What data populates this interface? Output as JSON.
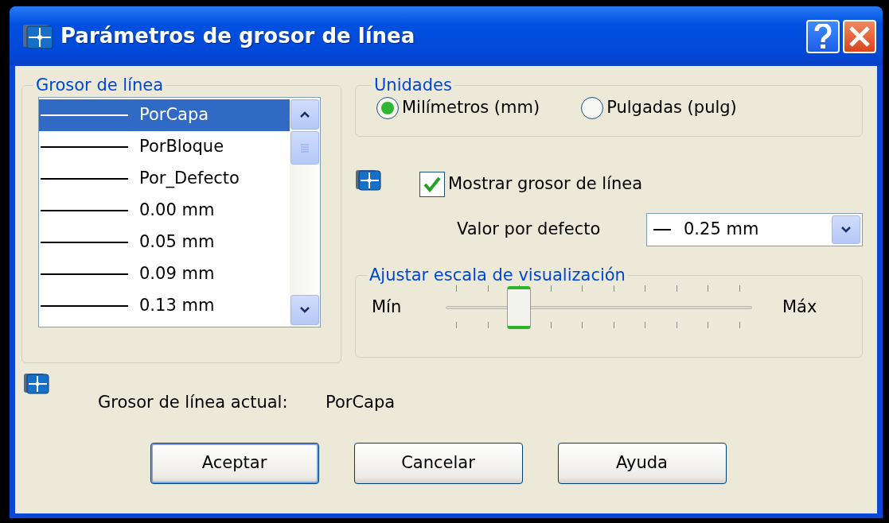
{
  "window": {
    "title": "Parámetros de grosor de línea"
  },
  "lineweights": {
    "title": "Grosor de línea",
    "items": [
      {
        "label": "PorCapa",
        "selected": true
      },
      {
        "label": "PorBloque",
        "selected": false
      },
      {
        "label": "Por_Defecto",
        "selected": false
      },
      {
        "label": "0.00 mm",
        "selected": false
      },
      {
        "label": "0.05 mm",
        "selected": false
      },
      {
        "label": "0.09 mm",
        "selected": false
      },
      {
        "label": "0.13 mm",
        "selected": false
      }
    ]
  },
  "units": {
    "title": "Unidades",
    "options": [
      {
        "label": "Milímetros (mm)",
        "selected": true
      },
      {
        "label": "Pulgadas (pulg)",
        "selected": false
      }
    ]
  },
  "show_lineweight": {
    "label": "Mostrar grosor de línea",
    "checked": true
  },
  "default_value": {
    "label": "Valor por defecto",
    "value": "0.25 mm"
  },
  "display_scale": {
    "title": "Ajustar escala de visualización",
    "min_label": "Mín",
    "max_label": "Máx",
    "level": 0.22
  },
  "current": {
    "label": "Grosor de línea actual:",
    "value": "PorCapa"
  },
  "buttons": [
    {
      "label": "Aceptar",
      "default": true
    },
    {
      "label": "Cancelar",
      "default": false
    },
    {
      "label": "Ayuda",
      "default": false
    }
  ]
}
